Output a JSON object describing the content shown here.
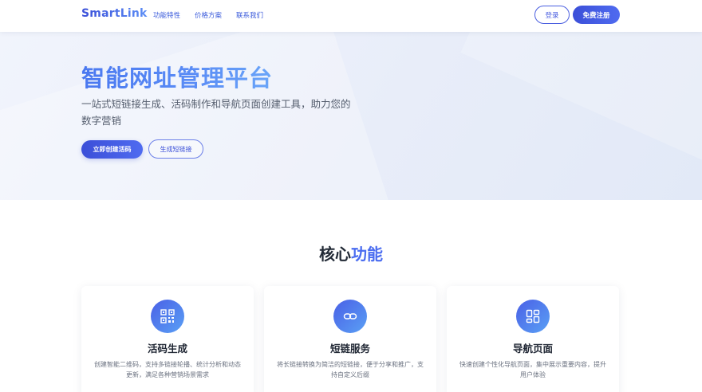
{
  "header": {
    "logo": "SmartLink",
    "nav": [
      "功能特性",
      "价格方案",
      "联系我们"
    ],
    "login_label": "登录",
    "register_label": "免费注册"
  },
  "hero": {
    "title": "智能网址管理平台",
    "subtitle": "一站式短链接生成、活码制作和导航页面创建工具，助力您的数字营销",
    "primary_button": "立即创建活码",
    "secondary_button": "生成短链接"
  },
  "features": {
    "title_prefix": "核心",
    "title_highlight": "功能",
    "cards": [
      {
        "icon": "qr-code-icon",
        "title": "活码生成",
        "desc": "创建智能二维码，支持多链接轮播、统计分析和动态更新，满足各种营销场景需求"
      },
      {
        "icon": "link-icon",
        "title": "短链服务",
        "desc": "将长链接转换为简洁的短链接，便于分享和推广，支持自定义后缀"
      },
      {
        "icon": "layout-icon",
        "title": "导航页面",
        "desc": "快速创建个性化导航页面，集中展示重要内容，提升用户体验"
      }
    ]
  },
  "colors": {
    "accent": "#3b4fd8",
    "accent_light": "#5b8df6",
    "hero_bg": "#eef2fb"
  }
}
